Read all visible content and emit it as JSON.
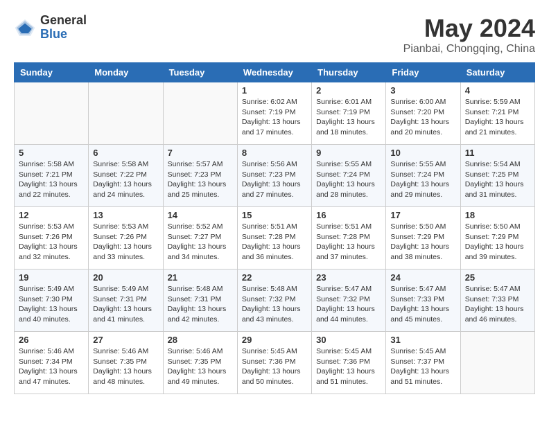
{
  "header": {
    "logo_general": "General",
    "logo_blue": "Blue",
    "month_title": "May 2024",
    "location": "Pianbai, Chongqing, China"
  },
  "weekdays": [
    "Sunday",
    "Monday",
    "Tuesday",
    "Wednesday",
    "Thursday",
    "Friday",
    "Saturday"
  ],
  "weeks": [
    [
      {
        "day": "",
        "info": ""
      },
      {
        "day": "",
        "info": ""
      },
      {
        "day": "",
        "info": ""
      },
      {
        "day": "1",
        "info": "Sunrise: 6:02 AM\nSunset: 7:19 PM\nDaylight: 13 hours\nand 17 minutes."
      },
      {
        "day": "2",
        "info": "Sunrise: 6:01 AM\nSunset: 7:19 PM\nDaylight: 13 hours\nand 18 minutes."
      },
      {
        "day": "3",
        "info": "Sunrise: 6:00 AM\nSunset: 7:20 PM\nDaylight: 13 hours\nand 20 minutes."
      },
      {
        "day": "4",
        "info": "Sunrise: 5:59 AM\nSunset: 7:21 PM\nDaylight: 13 hours\nand 21 minutes."
      }
    ],
    [
      {
        "day": "5",
        "info": "Sunrise: 5:58 AM\nSunset: 7:21 PM\nDaylight: 13 hours\nand 22 minutes."
      },
      {
        "day": "6",
        "info": "Sunrise: 5:58 AM\nSunset: 7:22 PM\nDaylight: 13 hours\nand 24 minutes."
      },
      {
        "day": "7",
        "info": "Sunrise: 5:57 AM\nSunset: 7:23 PM\nDaylight: 13 hours\nand 25 minutes."
      },
      {
        "day": "8",
        "info": "Sunrise: 5:56 AM\nSunset: 7:23 PM\nDaylight: 13 hours\nand 27 minutes."
      },
      {
        "day": "9",
        "info": "Sunrise: 5:55 AM\nSunset: 7:24 PM\nDaylight: 13 hours\nand 28 minutes."
      },
      {
        "day": "10",
        "info": "Sunrise: 5:55 AM\nSunset: 7:24 PM\nDaylight: 13 hours\nand 29 minutes."
      },
      {
        "day": "11",
        "info": "Sunrise: 5:54 AM\nSunset: 7:25 PM\nDaylight: 13 hours\nand 31 minutes."
      }
    ],
    [
      {
        "day": "12",
        "info": "Sunrise: 5:53 AM\nSunset: 7:26 PM\nDaylight: 13 hours\nand 32 minutes."
      },
      {
        "day": "13",
        "info": "Sunrise: 5:53 AM\nSunset: 7:26 PM\nDaylight: 13 hours\nand 33 minutes."
      },
      {
        "day": "14",
        "info": "Sunrise: 5:52 AM\nSunset: 7:27 PM\nDaylight: 13 hours\nand 34 minutes."
      },
      {
        "day": "15",
        "info": "Sunrise: 5:51 AM\nSunset: 7:28 PM\nDaylight: 13 hours\nand 36 minutes."
      },
      {
        "day": "16",
        "info": "Sunrise: 5:51 AM\nSunset: 7:28 PM\nDaylight: 13 hours\nand 37 minutes."
      },
      {
        "day": "17",
        "info": "Sunrise: 5:50 AM\nSunset: 7:29 PM\nDaylight: 13 hours\nand 38 minutes."
      },
      {
        "day": "18",
        "info": "Sunrise: 5:50 AM\nSunset: 7:29 PM\nDaylight: 13 hours\nand 39 minutes."
      }
    ],
    [
      {
        "day": "19",
        "info": "Sunrise: 5:49 AM\nSunset: 7:30 PM\nDaylight: 13 hours\nand 40 minutes."
      },
      {
        "day": "20",
        "info": "Sunrise: 5:49 AM\nSunset: 7:31 PM\nDaylight: 13 hours\nand 41 minutes."
      },
      {
        "day": "21",
        "info": "Sunrise: 5:48 AM\nSunset: 7:31 PM\nDaylight: 13 hours\nand 42 minutes."
      },
      {
        "day": "22",
        "info": "Sunrise: 5:48 AM\nSunset: 7:32 PM\nDaylight: 13 hours\nand 43 minutes."
      },
      {
        "day": "23",
        "info": "Sunrise: 5:47 AM\nSunset: 7:32 PM\nDaylight: 13 hours\nand 44 minutes."
      },
      {
        "day": "24",
        "info": "Sunrise: 5:47 AM\nSunset: 7:33 PM\nDaylight: 13 hours\nand 45 minutes."
      },
      {
        "day": "25",
        "info": "Sunrise: 5:47 AM\nSunset: 7:33 PM\nDaylight: 13 hours\nand 46 minutes."
      }
    ],
    [
      {
        "day": "26",
        "info": "Sunrise: 5:46 AM\nSunset: 7:34 PM\nDaylight: 13 hours\nand 47 minutes."
      },
      {
        "day": "27",
        "info": "Sunrise: 5:46 AM\nSunset: 7:35 PM\nDaylight: 13 hours\nand 48 minutes."
      },
      {
        "day": "28",
        "info": "Sunrise: 5:46 AM\nSunset: 7:35 PM\nDaylight: 13 hours\nand 49 minutes."
      },
      {
        "day": "29",
        "info": "Sunrise: 5:45 AM\nSunset: 7:36 PM\nDaylight: 13 hours\nand 50 minutes."
      },
      {
        "day": "30",
        "info": "Sunrise: 5:45 AM\nSunset: 7:36 PM\nDaylight: 13 hours\nand 51 minutes."
      },
      {
        "day": "31",
        "info": "Sunrise: 5:45 AM\nSunset: 7:37 PM\nDaylight: 13 hours\nand 51 minutes."
      },
      {
        "day": "",
        "info": ""
      }
    ]
  ]
}
